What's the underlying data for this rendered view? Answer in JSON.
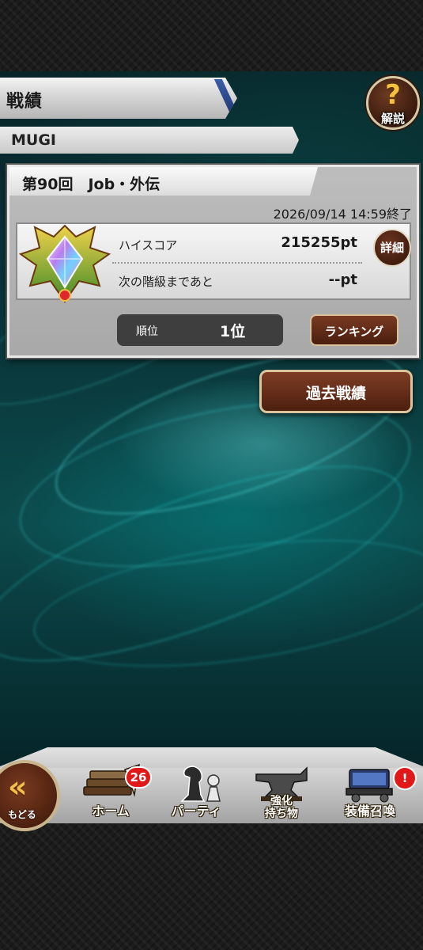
{
  "header": {
    "title": "戦績",
    "help_icon": "?",
    "help_label": "解説"
  },
  "player": {
    "name": "MUGI"
  },
  "event": {
    "title": "第90回　Job・外伝",
    "end_time": "2026/09/14 14:59終了",
    "highscore_label": "ハイスコア",
    "highscore_value": "215255pt",
    "next_rank_label": "次の階級まであと",
    "next_rank_value": "--pt",
    "detail_button": "詳細",
    "rank_label": "順位",
    "rank_value": "1位",
    "ranking_button": "ランキング"
  },
  "past_results_button": "過去戦績",
  "nav": {
    "back_icon": "«",
    "back_label": "もどる",
    "items": [
      {
        "label": "ホーム",
        "icon": "books-icon",
        "badge": "26"
      },
      {
        "label": "パーティ",
        "icon": "chess-pieces-icon"
      },
      {
        "label_line1": "強化",
        "label_line2": "持ち物",
        "icon": "anvil-icon"
      },
      {
        "label": "装備召喚",
        "icon": "summon-device-icon",
        "badge": "!"
      }
    ]
  },
  "colors": {
    "accent_brown": "#5a2812",
    "badge_red": "#e01818",
    "gold": "#f2c04a"
  }
}
